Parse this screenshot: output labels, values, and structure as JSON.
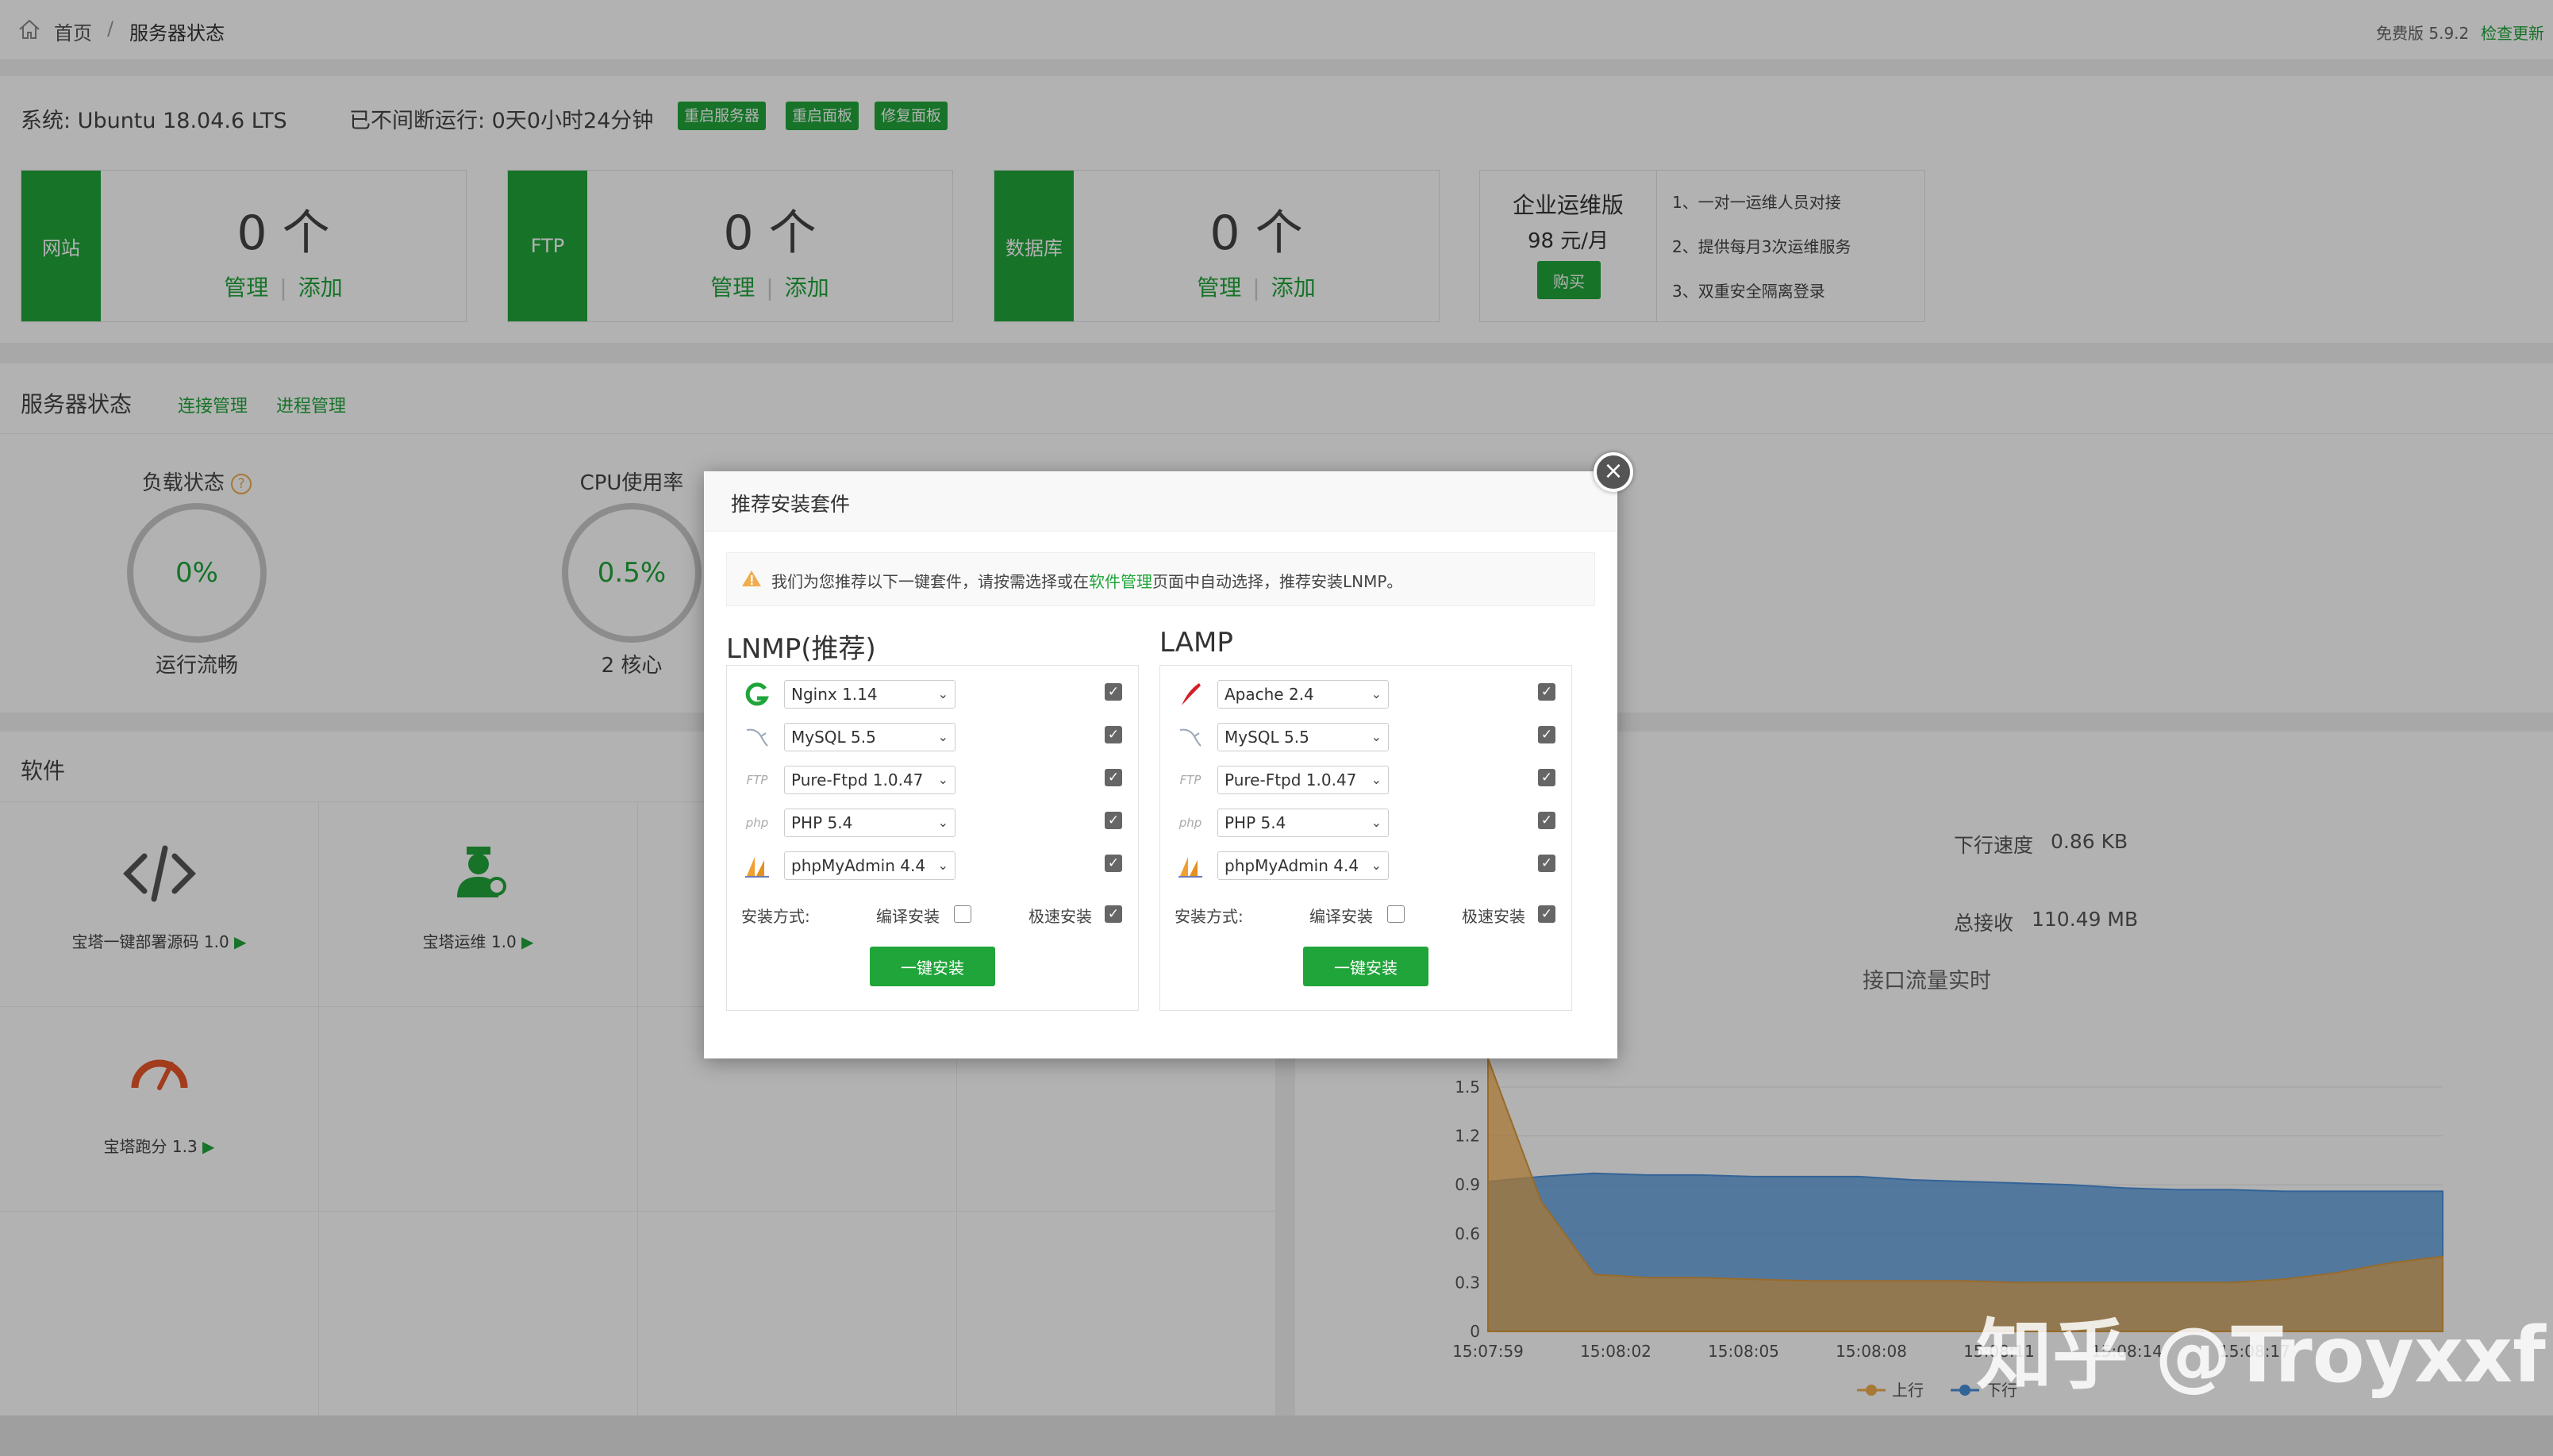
{
  "breadcrumb": {
    "home": "首页",
    "sep": "/",
    "current": "服务器状态"
  },
  "header": {
    "version": "免费版 5.9.2",
    "check_update": "检查更新"
  },
  "system": {
    "os": "系统: Ubuntu 18.04.6 LTS",
    "uptime": "已不间断运行: 0天0小时24分钟",
    "buttons": [
      "重启服务器",
      "重启面板",
      "修复面板"
    ]
  },
  "stats": [
    {
      "label": "网站",
      "count": "0 个",
      "manage": "管理",
      "add": "添加"
    },
    {
      "label": "FTP",
      "count": "0 个",
      "manage": "管理",
      "add": "添加"
    },
    {
      "label": "数据库",
      "count": "0 个",
      "manage": "管理",
      "add": "添加"
    }
  ],
  "enterprise": {
    "title": "企业运维版",
    "price": "98 元/月",
    "buy": "购买",
    "features": [
      "1、一对一运维人员对接",
      "2、提供每月3次运维服务",
      "3、双重安全隔离登录"
    ]
  },
  "server_status": {
    "title": "服务器状态",
    "links": [
      "连接管理",
      "进程管理"
    ],
    "load": {
      "label": "负载状态",
      "value": "0%",
      "sub": "运行流畅"
    },
    "cpu": {
      "label": "CPU使用率",
      "value": "0.5%",
      "sub": "2 核心"
    }
  },
  "software": {
    "title": "软件",
    "items": [
      {
        "label": "宝塔一键部署源码 1.0",
        "icon": "code-icon"
      },
      {
        "label": "宝塔运维 1.0",
        "icon": "operator-icon"
      },
      {
        "label": "宝塔跑分 1.3",
        "icon": "speedometer-icon"
      }
    ]
  },
  "network": {
    "down_label": "下行速度",
    "down_value": "0.86 KB",
    "recv_label": "总接收",
    "recv_value": "110.49 MB",
    "chart_title": "接口流量实时"
  },
  "chart_data": {
    "type": "area",
    "x": [
      "15:07:59",
      "15:08:02",
      "15:08:05",
      "15:08:08",
      "15:08:11",
      "15:08:14",
      "15:08:17"
    ],
    "ylim": [
      0,
      1.5
    ],
    "yticks": [
      "1.5",
      "1.2",
      "0.9",
      "0.6",
      "0.3",
      "0"
    ],
    "series": [
      {
        "name": "上行",
        "color": "#f0ad4e",
        "values": [
          1.8,
          0.8,
          0.35,
          0.33,
          0.33,
          0.32,
          0.31,
          0.31,
          0.31,
          0.31,
          0.3,
          0.3,
          0.3,
          0.3,
          0.3,
          0.32,
          0.36,
          0.42,
          0.46
        ]
      },
      {
        "name": "下行",
        "color": "#4a90d9",
        "values": [
          0.92,
          0.95,
          0.97,
          0.96,
          0.96,
          0.95,
          0.95,
          0.95,
          0.93,
          0.92,
          0.91,
          0.9,
          0.88,
          0.87,
          0.87,
          0.86,
          0.86,
          0.86,
          0.86
        ]
      }
    ],
    "legend": "bottom"
  },
  "modal": {
    "title": "推荐安装套件",
    "tip_pre": "我们为您推荐以下一键套件，请按需选择或在",
    "tip_link": "软件管理",
    "tip_post": "页面中自动选择，推荐安装LNMP。",
    "close": "×",
    "method_label": "安装方式:",
    "compile_label": "编译安装",
    "fast_label": "极速安装",
    "install_label": "一键安装",
    "lnmp": {
      "title": "LNMP(推荐)",
      "items": [
        {
          "icon": "nginx-icon",
          "value": "Nginx 1.14"
        },
        {
          "icon": "mysql-icon",
          "value": "MySQL 5.5"
        },
        {
          "icon": "ftp-icon",
          "value": "Pure-Ftpd 1.0.47"
        },
        {
          "icon": "php-icon",
          "value": "PHP 5.4"
        },
        {
          "icon": "phpmyadmin-icon",
          "value": "phpMyAdmin 4.4"
        }
      ]
    },
    "lamp": {
      "title": "LAMP",
      "items": [
        {
          "icon": "apache-icon",
          "value": "Apache 2.4"
        },
        {
          "icon": "mysql-icon",
          "value": "MySQL 5.5"
        },
        {
          "icon": "ftp-icon",
          "value": "Pure-Ftpd 1.0.47"
        },
        {
          "icon": "php-icon",
          "value": "PHP 5.4"
        },
        {
          "icon": "phpmyadmin-icon",
          "value": "phpMyAdmin 4.4"
        }
      ]
    },
    "ftp_icon_text": "FTP",
    "php_icon_text": "php"
  },
  "watermark": "知乎 @Troyxxf"
}
